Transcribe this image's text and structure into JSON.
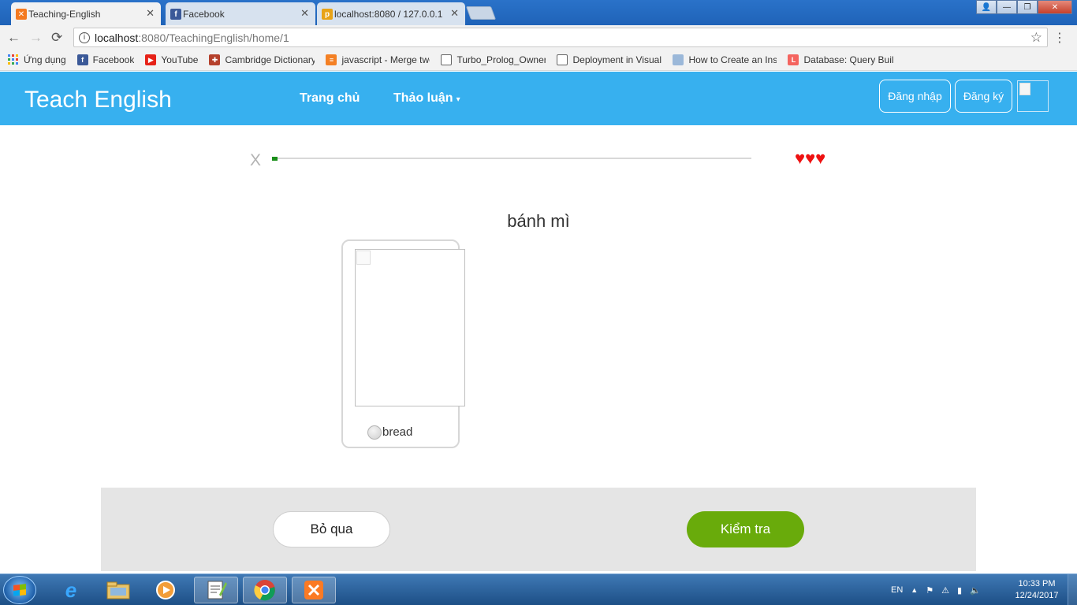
{
  "browser": {
    "tabs": [
      {
        "title": "Teaching-English",
        "close": "✕",
        "icon": "xampp-icon",
        "color": "#f47a20"
      },
      {
        "title": "Facebook",
        "close": "✕",
        "icon": "facebook-icon",
        "color": "#3b5998"
      },
      {
        "title": "localhost:8080 / 127.0.0.1",
        "close": "✕",
        "icon": "phpmyadmin-icon",
        "color": "#e8a317"
      }
    ],
    "window_controls": {
      "user": "👤",
      "minimize": "—",
      "maximize": "❐",
      "close": "✕"
    },
    "address": {
      "host": "localhost",
      "path": ":8080/TeachingEnglish/home/1",
      "info": "i"
    },
    "nav": {
      "back": "←",
      "forward": "→",
      "reload": "⟳",
      "star": "☆",
      "menu": "⋮"
    },
    "bookmarks": [
      {
        "label": "Ứng dụng",
        "icon": "apps-grid-icon",
        "color": "#4285f4"
      },
      {
        "label": "Facebook",
        "icon": "facebook-icon",
        "color": "#3b5998"
      },
      {
        "label": "YouTube",
        "icon": "youtube-icon",
        "color": "#e62117"
      },
      {
        "label": "Cambridge Dictionary",
        "icon": "cambridge-crest-icon",
        "color": "#b5412c"
      },
      {
        "label": "javascript - Merge two",
        "icon": "stackoverflow-icon",
        "color": "#f48024"
      },
      {
        "label": "Turbo_Prolog_Owner",
        "icon": "document-icon",
        "color": "#ffffff"
      },
      {
        "label": "Deployment in Visual",
        "icon": "document-icon",
        "color": "#ffffff"
      },
      {
        "label": "How to Create an Inst",
        "icon": "page-icon",
        "color": "#9bb8d9"
      },
      {
        "label": "Database: Query Build",
        "icon": "laravel-icon",
        "color": "#f4645f"
      }
    ]
  },
  "app": {
    "brand": "Teach English",
    "nav": {
      "home": "Trang chủ",
      "discussion": "Thảo luận",
      "caret": "▾"
    },
    "login": "Đăng nhập",
    "register": "Đăng ký",
    "accent": "#37b0ef"
  },
  "lesson": {
    "quit": "X",
    "progress": 0.012,
    "lives": 3,
    "heart_glyph": "♥",
    "prompt": "bánh mì",
    "options": [
      {
        "label": "bread"
      }
    ],
    "skip": "Bỏ qua",
    "check": "Kiểm tra",
    "check_color": "#69ab0b"
  },
  "taskbar": {
    "pinned": [
      "internet-explorer-icon",
      "file-explorer-icon",
      "media-player-icon",
      "notepad-plus-icon",
      "chrome-icon",
      "xampp-icon"
    ],
    "tray": {
      "lang": "EN",
      "up_arrow": "▲"
    },
    "time": "10:33 PM",
    "date": "12/24/2017"
  }
}
